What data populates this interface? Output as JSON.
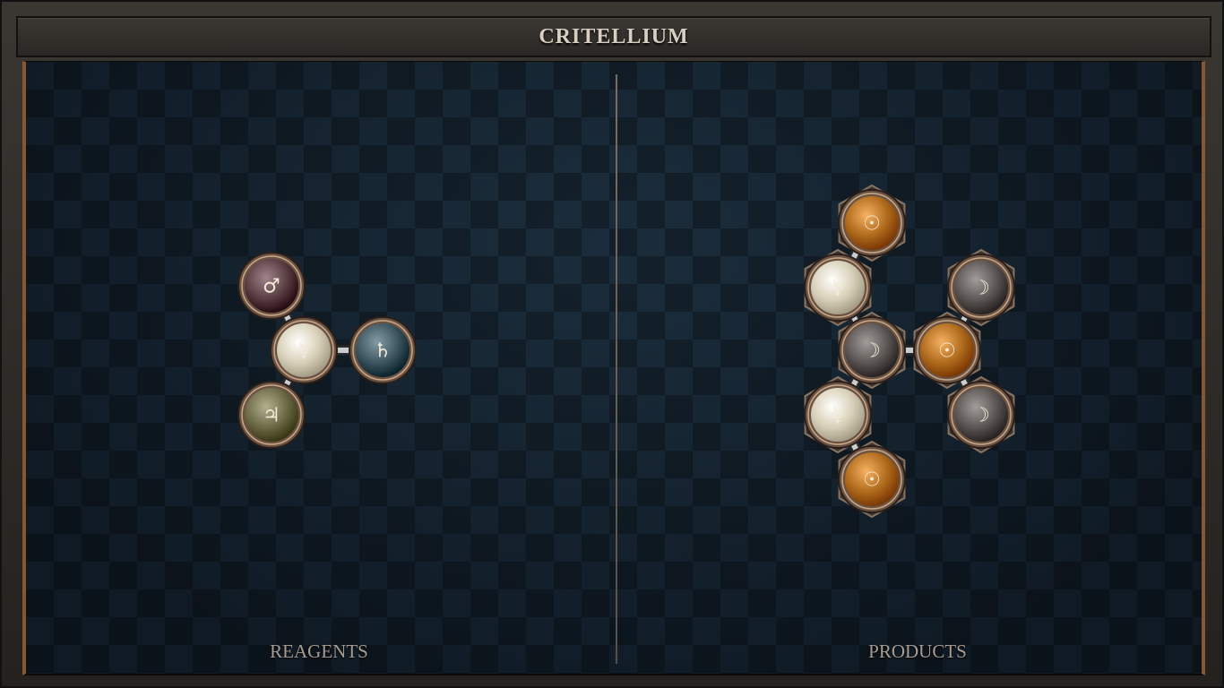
{
  "title": "CRITELLIUM",
  "panels": {
    "reagents_label": "REAGENTS",
    "products_label": "PRODUCTS"
  },
  "reagents": {
    "atoms": [
      {
        "id": "r1",
        "element": "mars",
        "glyph": "♂",
        "color": "#5a3f45"
      },
      {
        "id": "r2",
        "element": "quicksilver",
        "glyph": "☿",
        "color": "#d8d0b8"
      },
      {
        "id": "r3",
        "element": "lead",
        "glyph": "♄",
        "color": "#3e5660"
      },
      {
        "id": "r4",
        "element": "tin",
        "glyph": "♃",
        "color": "#6d6a48"
      }
    ],
    "bonds": [
      [
        "r1",
        "r2"
      ],
      [
        "r2",
        "r3"
      ],
      [
        "r2",
        "r4"
      ]
    ]
  },
  "products": {
    "atoms": [
      {
        "id": "p1",
        "element": "gold",
        "glyph": "☉",
        "color": "#b06c1c"
      },
      {
        "id": "p2",
        "element": "quicksilver",
        "glyph": "☿",
        "color": "#d8d0b8"
      },
      {
        "id": "p3",
        "element": "silver",
        "glyph": "☽",
        "color": "#5c5654"
      },
      {
        "id": "p4",
        "element": "quicksilver",
        "glyph": "☿",
        "color": "#d8d0b8"
      },
      {
        "id": "p5",
        "element": "gold",
        "glyph": "☉",
        "color": "#b06c1c"
      },
      {
        "id": "p6",
        "element": "silver",
        "glyph": "☽",
        "color": "#5c5654"
      },
      {
        "id": "p7",
        "element": "gold",
        "glyph": "☉",
        "color": "#b06c1c"
      },
      {
        "id": "p8",
        "element": "silver",
        "glyph": "☽",
        "color": "#5c5654"
      }
    ],
    "bonds": [
      [
        "p1",
        "p2"
      ],
      [
        "p2",
        "p3"
      ],
      [
        "p3",
        "p4"
      ],
      [
        "p4",
        "p5"
      ],
      [
        "p3",
        "p7"
      ],
      [
        "p7",
        "p6"
      ],
      [
        "p7",
        "p8"
      ]
    ]
  },
  "colors": {
    "frame_accent": "#8a5630",
    "board_background": "#13212d",
    "label_text": "#a79d92"
  }
}
